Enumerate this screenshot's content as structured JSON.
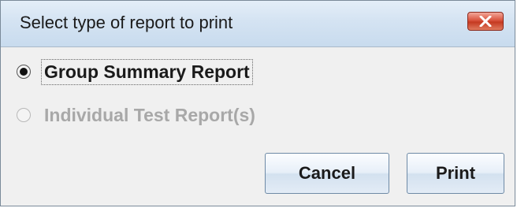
{
  "dialog": {
    "title": "Select type of report to print",
    "close_icon": "close-icon"
  },
  "options": [
    {
      "label": "Group Summary Report",
      "selected": true,
      "enabled": true
    },
    {
      "label": "Individual Test Report(s)",
      "selected": false,
      "enabled": false
    }
  ],
  "buttons": {
    "cancel_label": "Cancel",
    "print_label": "Print"
  },
  "colors": {
    "titlebar": "#d4e3f2",
    "close_button": "#d9533d",
    "background": "#f0f0f0",
    "disabled_text": "#a8a8a8"
  }
}
